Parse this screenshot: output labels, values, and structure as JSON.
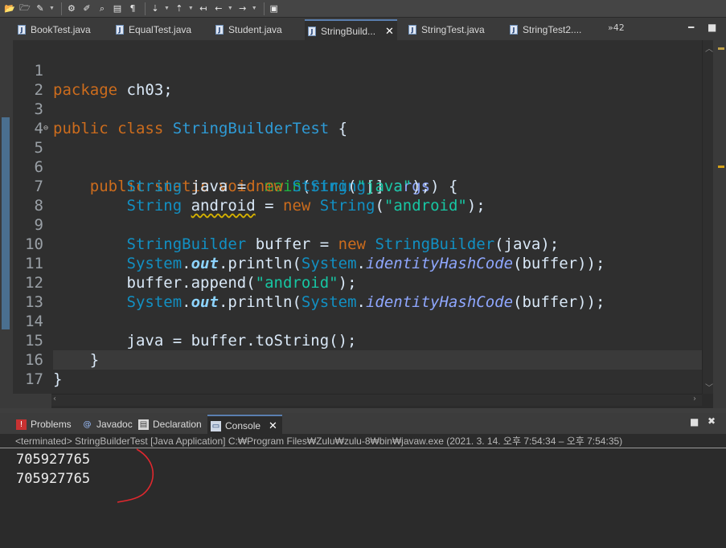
{
  "toolbar": {
    "icons": [
      "open-icon",
      "new-folder-icon",
      "brush-icon",
      "debug-icon",
      "edit-icon",
      "search-icon",
      "build-icon",
      "pilcrow-icon",
      "next-annotation-icon",
      "prev-annotation-icon",
      "back-icon",
      "forward-icon",
      "task-icon"
    ]
  },
  "editor_tabs": [
    {
      "label": "BookTest.java"
    },
    {
      "label": "EqualTest.java"
    },
    {
      "label": "Student.java"
    },
    {
      "label": "StringBuild..."
    },
    {
      "label": "StringTest.java"
    },
    {
      "label": "StringTest2...."
    }
  ],
  "tab_overflow": "»42",
  "active_close": "✕",
  "line_numbers": [
    "1",
    "2",
    "3",
    "4",
    "5",
    "6",
    "7",
    "8",
    "9",
    "10",
    "11",
    "12",
    "13",
    "14",
    "15",
    "16",
    "17"
  ],
  "code": {
    "l1_kw": "package",
    "l1_rest": " ch03;",
    "l3_kw1": "public",
    "l3_kw2": "class",
    "l3_cls": "StringBuilderTest",
    "l3_rest": " {",
    "l5_kw1": "public",
    "l5_kw2": "static",
    "l5_kw3": "void",
    "l5_fn": "main",
    "l5_p1": "(",
    "l5_ty": "String",
    "l5_p2": "[] ",
    "l5_arg": "args",
    "l5_p3": ") {",
    "l6_ty": "String",
    "l6_var": "java",
    "l6_eq": " = ",
    "l6_new": "new",
    "l6_ty2": "String",
    "l6_p1": "(",
    "l6_str": "\"java\"",
    "l6_p2": ");",
    "l7_ty": "String",
    "l7_var": "android",
    "l7_eq": " = ",
    "l7_new": "new",
    "l7_ty2": "String",
    "l7_p1": "(",
    "l7_str": "\"android\"",
    "l7_p2": ");",
    "l9_ty": "StringBuilder",
    "l9_var": "buffer",
    "l9_eq": " = ",
    "l9_new": "new",
    "l9_ty2": "StringBuilder",
    "l9_p1": "(java);",
    "l10_sys": "System",
    "l10_dot": ".",
    "l10_out": "out",
    "l10_m": ".println(",
    "l10_sys2": "System",
    "l10_dot2": ".",
    "l10_ih": "identityHashCode",
    "l10_end": "(buffer));",
    "l11": "buffer.append(",
    "l11_str": "\"android\"",
    "l11_end": ");",
    "l12_sys": "System",
    "l12_dot": ".",
    "l12_out": "out",
    "l12_m": ".println(",
    "l12_sys2": "System",
    "l12_dot2": ".",
    "l12_ih": "identityHashCode",
    "l12_end": "(buffer));",
    "l14": "java = buffer.toString();",
    "l15": "}",
    "l16": "}"
  },
  "console_tabs": [
    {
      "label": "Problems"
    },
    {
      "label": "Javadoc"
    },
    {
      "label": "Declaration"
    },
    {
      "label": "Console"
    }
  ],
  "console_status": "<terminated> StringBuilderTest [Java Application] C:₩Program Files₩Zulu₩zulu-8₩bin₩javaw.exe  (2021. 3. 14. 오후 7:54:34 – 오후 7:54:35)",
  "console_output": [
    "705927765",
    "705927765"
  ],
  "colors": {
    "keyword": "#cc6c1d",
    "type": "#1290c3",
    "string": "#17c6a3",
    "annotation_stroke": "#e0282e"
  }
}
